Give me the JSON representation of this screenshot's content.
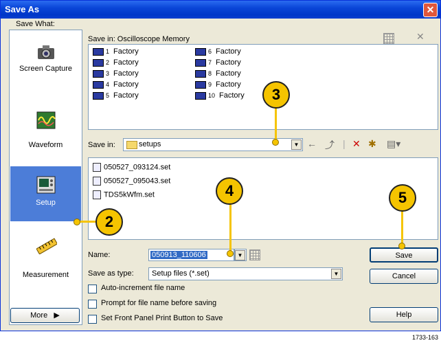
{
  "window": {
    "title": "Save As"
  },
  "left_panel": {
    "header": "Save What:",
    "items": [
      {
        "label": "Screen Capture",
        "icon": "camera-icon"
      },
      {
        "label": "Waveform",
        "icon": "waveform-icon"
      },
      {
        "label": "Setup",
        "icon": "setup-icon",
        "selected": true
      },
      {
        "label": "Measurement",
        "icon": "ruler-icon"
      }
    ],
    "more_label": "More",
    "more_arrow": "▶"
  },
  "memory": {
    "label": "Save in: Oscilloscope Memory",
    "items": [
      {
        "num": "1",
        "name": "Factory"
      },
      {
        "num": "2",
        "name": "Factory"
      },
      {
        "num": "3",
        "name": "Factory"
      },
      {
        "num": "4",
        "name": "Factory"
      },
      {
        "num": "5",
        "name": "Factory"
      },
      {
        "num": "6",
        "name": "Factory"
      },
      {
        "num": "7",
        "name": "Factory"
      },
      {
        "num": "8",
        "name": "Factory"
      },
      {
        "num": "9",
        "name": "Factory"
      },
      {
        "num": "10",
        "name": "Factory"
      }
    ]
  },
  "save_in": {
    "label": "Save in:",
    "folder": "setups"
  },
  "files": [
    "050527_093124.set",
    "050527_095043.set",
    "TDS5kWfm.set"
  ],
  "name_field": {
    "label": "Name:",
    "value": "050913_110606"
  },
  "save_as_type": {
    "label": "Save as type:",
    "value": "Setup files (*.set)"
  },
  "checkboxes": [
    {
      "label": "Auto-increment file name"
    },
    {
      "label": "Prompt for file name before saving"
    },
    {
      "label": "Set Front Panel Print Button to Save"
    }
  ],
  "buttons": {
    "save": "Save",
    "cancel": "Cancel",
    "help": "Help"
  },
  "callouts": [
    "2",
    "3",
    "4",
    "5"
  ],
  "footnote": "1733-163",
  "colors": {
    "callout": "#f5c400",
    "titlebar": "#0a46d8",
    "selection": "#316ac5"
  }
}
